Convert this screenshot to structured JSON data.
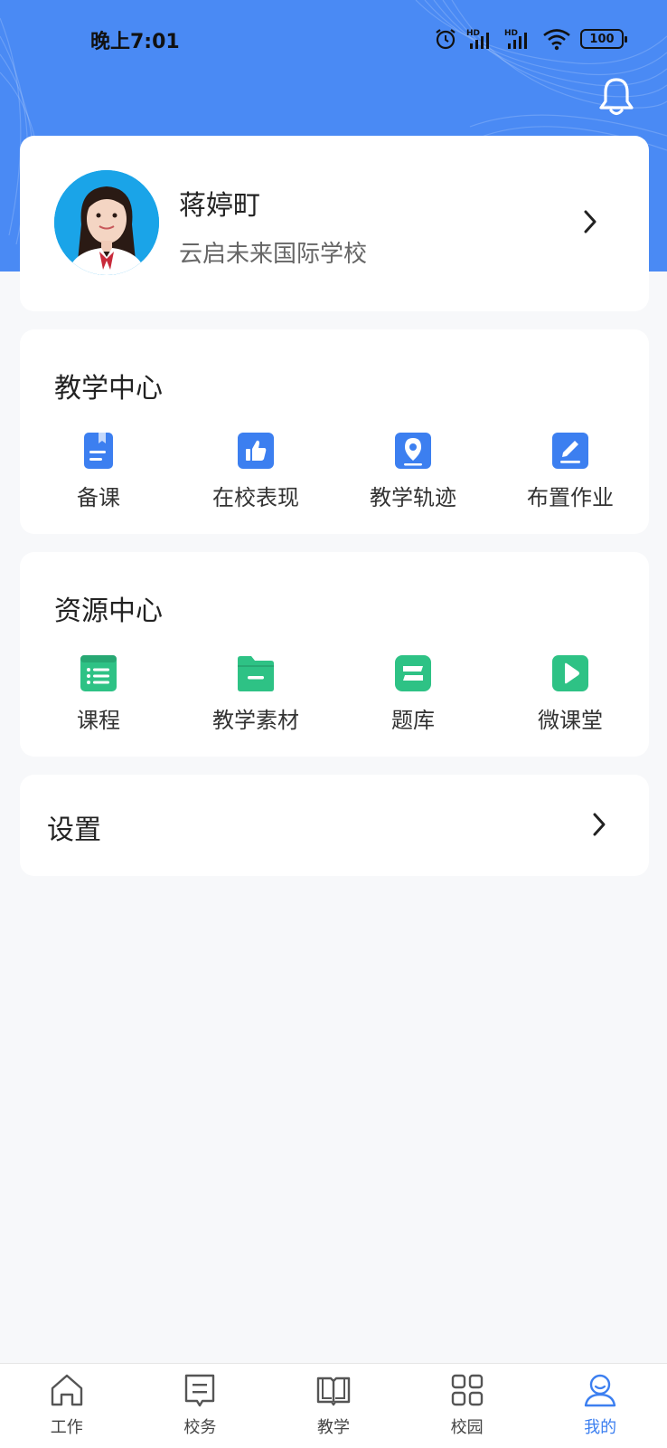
{
  "status_bar": {
    "time": "晚上7:01",
    "battery": "100",
    "icons": [
      "alarm-icon",
      "signal-hd-icon",
      "signal-hd-icon",
      "wifi-icon",
      "battery-icon"
    ]
  },
  "header": {
    "bell_icon": "bell-icon",
    "accent_color": "#4a8af4"
  },
  "profile": {
    "name": "蒋婷町",
    "school": "云启未来国际学校",
    "avatar_icon": "avatar"
  },
  "teaching_center": {
    "title": "教学中心",
    "icon_color": "#3c7ff0",
    "items": [
      {
        "label": "备课",
        "icon": "book-icon"
      },
      {
        "label": "在校表现",
        "icon": "thumbs-up-icon"
      },
      {
        "label": "教学轨迹",
        "icon": "location-pin-icon"
      },
      {
        "label": "布置作业",
        "icon": "edit-icon"
      }
    ]
  },
  "resource_center": {
    "title": "资源中心",
    "icon_color": "#2ec285",
    "items": [
      {
        "label": "课程",
        "icon": "list-icon"
      },
      {
        "label": "教学素材",
        "icon": "folder-icon"
      },
      {
        "label": "题库",
        "icon": "question-bank-icon"
      },
      {
        "label": "微课堂",
        "icon": "video-play-icon"
      }
    ]
  },
  "settings": {
    "label": "设置"
  },
  "tabbar": {
    "active_color": "#3c7ff0",
    "tabs": [
      {
        "label": "工作",
        "icon": "home-icon"
      },
      {
        "label": "校务",
        "icon": "document-icon"
      },
      {
        "label": "教学",
        "icon": "open-book-icon"
      },
      {
        "label": "校园",
        "icon": "grid-icon"
      },
      {
        "label": "我的",
        "icon": "user-icon",
        "active": true
      }
    ]
  }
}
